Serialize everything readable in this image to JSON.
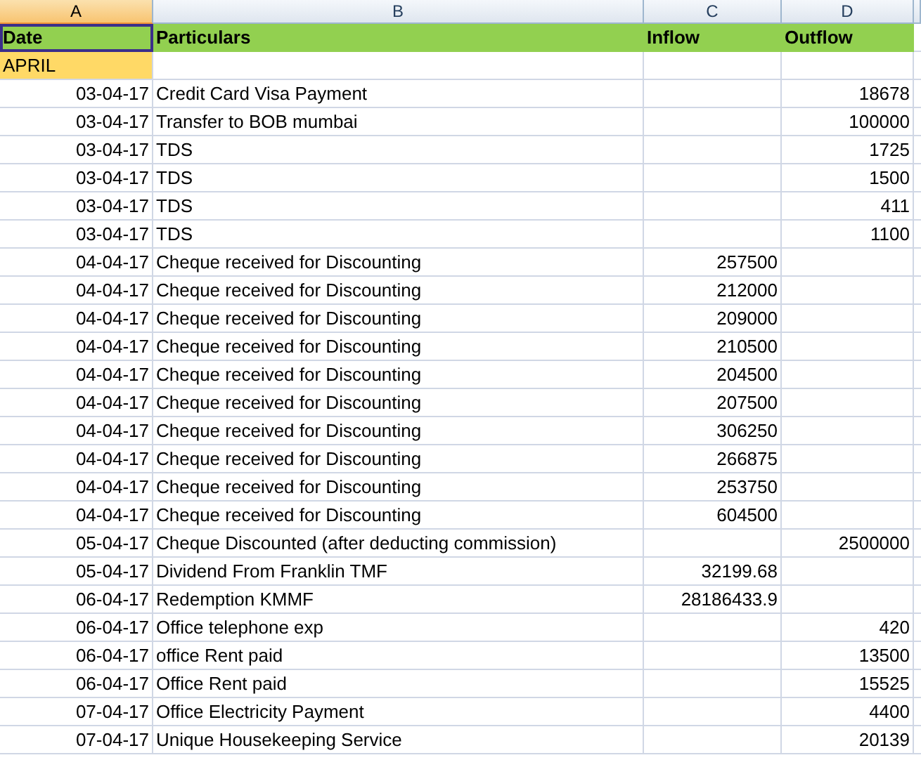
{
  "columns": [
    {
      "label": "A",
      "selected": true
    },
    {
      "label": "B",
      "selected": false
    },
    {
      "label": "C",
      "selected": false
    },
    {
      "label": "D",
      "selected": false
    }
  ],
  "header_row": [
    {
      "text": "Date",
      "selected": true
    },
    {
      "text": "Particulars",
      "selected": false
    },
    {
      "text": "Inflow",
      "selected": false
    },
    {
      "text": "Outflow",
      "selected": false
    }
  ],
  "month_label": "APRIL",
  "rows": [
    {
      "date": "03-04-17",
      "particulars": "Credit Card Visa Payment",
      "outflow": "18678"
    },
    {
      "date": "03-04-17",
      "particulars": "Transfer to BOB mumbai",
      "outflow": "100000"
    },
    {
      "date": "03-04-17",
      "particulars": "TDS",
      "outflow": "1725"
    },
    {
      "date": "03-04-17",
      "particulars": "TDS",
      "outflow": "1500"
    },
    {
      "date": "03-04-17",
      "particulars": "TDS",
      "outflow": "411"
    },
    {
      "date": "03-04-17",
      "particulars": "TDS",
      "outflow": "1100"
    },
    {
      "date": "04-04-17",
      "particulars": "Cheque received for Discounting",
      "inflow": "257500"
    },
    {
      "date": "04-04-17",
      "particulars": "Cheque received for Discounting",
      "inflow": "212000"
    },
    {
      "date": "04-04-17",
      "particulars": "Cheque received for Discounting",
      "inflow": "209000"
    },
    {
      "date": "04-04-17",
      "particulars": "Cheque received for Discounting",
      "inflow": "210500"
    },
    {
      "date": "04-04-17",
      "particulars": "Cheque received for Discounting",
      "inflow": "204500"
    },
    {
      "date": "04-04-17",
      "particulars": "Cheque received for Discounting",
      "inflow": "207500"
    },
    {
      "date": "04-04-17",
      "particulars": "Cheque received for Discounting",
      "inflow": "306250"
    },
    {
      "date": "04-04-17",
      "particulars": "Cheque received for Discounting",
      "inflow": "266875"
    },
    {
      "date": "04-04-17",
      "particulars": "Cheque received for Discounting",
      "inflow": "253750"
    },
    {
      "date": "04-04-17",
      "particulars": "Cheque received for Discounting",
      "inflow": "604500"
    },
    {
      "date": "05-04-17",
      "particulars": "Cheque Discounted (after deducting commission)",
      "outflow": "2500000"
    },
    {
      "date": "05-04-17",
      "particulars": "Dividend From Franklin TMF",
      "inflow": "32199.68"
    },
    {
      "date": "06-04-17",
      "particulars": "Redemption KMMF",
      "inflow": "28186433.9"
    },
    {
      "date": "06-04-17",
      "particulars": "Office telephone exp",
      "outflow": "420"
    },
    {
      "date": "06-04-17",
      "particulars": "office Rent paid",
      "outflow": "13500"
    },
    {
      "date": "06-04-17",
      "particulars": "Office Rent paid",
      "outflow": "15525"
    },
    {
      "date": "07-04-17",
      "particulars": "Office Electricity Payment",
      "outflow": "4400"
    },
    {
      "date": "07-04-17",
      "particulars": "Unique Housekeeping Service",
      "outflow": "20139"
    }
  ]
}
